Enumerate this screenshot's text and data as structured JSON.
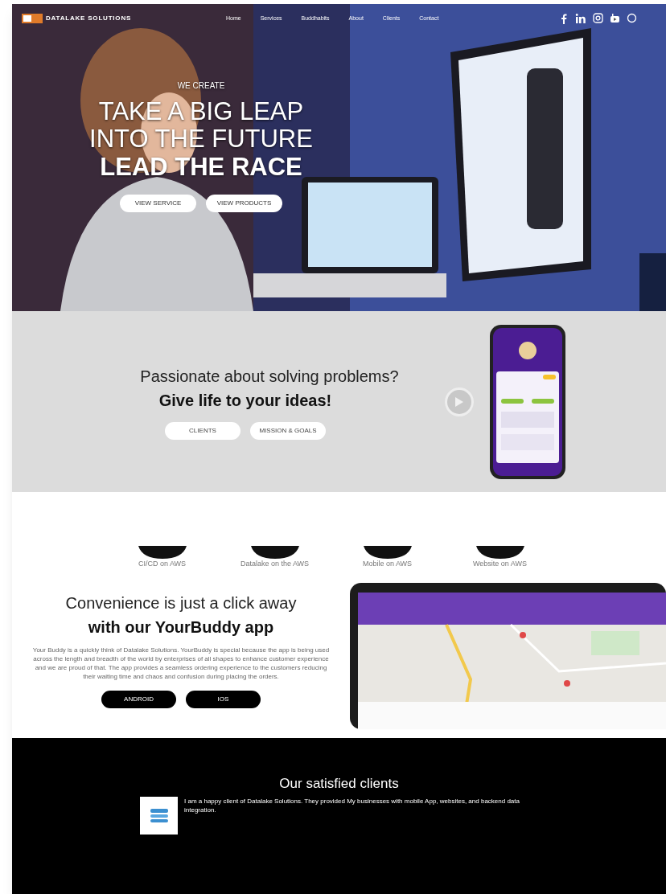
{
  "header": {
    "logo_text": "DATALAKE SOLUTIONS",
    "nav": [
      {
        "label": "Home"
      },
      {
        "label": "Services"
      },
      {
        "label": "Buddhabits"
      },
      {
        "label": "About"
      },
      {
        "label": "Clients"
      },
      {
        "label": "Contact"
      }
    ]
  },
  "hero": {
    "eyebrow": "WE CREATE",
    "lines": [
      "TAKE A BIG LEAP",
      "INTO THE FUTURE"
    ],
    "emphasis": "LEAD THE RACE",
    "buttons": [
      "VIEW SERVICE",
      "VIEW PRODUCTS"
    ]
  },
  "intro": {
    "title": "Passionate about solving problems?",
    "subtitle": "Give life to your ideas!",
    "buttons": [
      "CLIENTS",
      "MISSION & GOALS"
    ]
  },
  "services": [
    {
      "label": "CI/CD on AWS"
    },
    {
      "label": "Datalake on the AWS"
    },
    {
      "label": "Mobile on AWS"
    },
    {
      "label": "Website on AWS"
    }
  ],
  "app": {
    "title": "Convenience is just a click away",
    "subtitle": "with our YourBuddy app",
    "description": "Your Buddy is a quickly think of Datalake Solutions. YourBuddy is special because the app is being used across the length and breadth of the world by enterprises of all shapes to enhance customer experience and we are proud of that. The app provides a seamless ordering experience to the customers reducing their waiting time and chaos and confusion during placing the orders.",
    "buttons": [
      "ANDROID",
      "IOS"
    ]
  },
  "clients": {
    "title": "Our satisfied clients",
    "testimonials": [
      {
        "text": "I am a happy client of Datalake Solutions. They provided My businesses with mobile App, websites, and backend data integration."
      }
    ]
  }
}
